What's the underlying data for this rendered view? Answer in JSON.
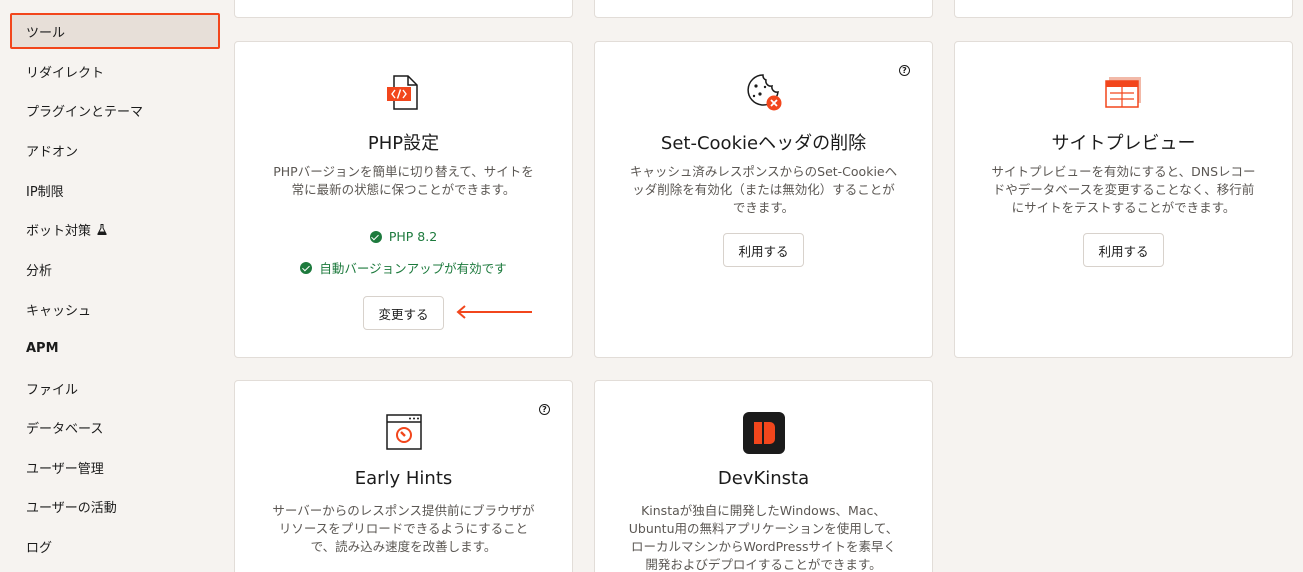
{
  "sidebar": {
    "items": [
      {
        "label": "ツール",
        "active": true
      },
      {
        "label": "リダイレクト"
      },
      {
        "label": "プラグインとテーマ"
      },
      {
        "label": "アドオン"
      },
      {
        "label": "IP制限"
      },
      {
        "label": "ボット対策"
      },
      {
        "label": "分析"
      },
      {
        "label": "キャッシュ"
      },
      {
        "label": "APM"
      },
      {
        "label": "ファイル"
      },
      {
        "label": "データベース"
      },
      {
        "label": "ユーザー管理"
      },
      {
        "label": "ユーザーの活動"
      },
      {
        "label": "ログ"
      }
    ]
  },
  "cards": {
    "php": {
      "title": "PHP設定",
      "desc1": "PHPバージョンを簡単に切り替えて、サイトを",
      "desc2": "常に最新の状態に保つことができます。",
      "status1": "PHP 8.2",
      "status2": "自動バージョンアップが有効です",
      "button": "変更する",
      "icon": "php-code-file-icon"
    },
    "cookie": {
      "title": "Set-Cookieヘッダの削除",
      "desc1": "キャッシュ済みレスポンスからのSet-Cookieヘ",
      "desc2": "ッダ削除を有効化（または無効化）することが",
      "desc3": "できます。",
      "button": "利用する",
      "icon": "cookie-remove-icon"
    },
    "preview": {
      "title": "サイトプレビュー",
      "desc1": "サイトプレビューを有効にすると、DNSレコー",
      "desc2": "ドやデータベースを変更することなく、移行前",
      "desc3": "にサイトをテストすることができます。",
      "button": "利用する",
      "icon": "site-preview-icon"
    },
    "hints": {
      "title": "Early Hints",
      "desc1": "サーバーからのレスポンス提供前にブラウザが",
      "desc2": "リソースをプリロードできるようにすること",
      "desc3": "で、読み込み速度を改善します。",
      "icon": "early-hints-icon"
    },
    "devkinsta": {
      "title": "DevKinsta",
      "desc1": "Kinstaが独自に開発したWindows、Mac、",
      "desc2": "Ubuntu用の無料アプリケーションを使用して、",
      "desc3": "ローカルマシンからWordPressサイトを素早く",
      "desc4": "開発およびデプロイすることができます。",
      "icon": "devkinsta-logo-icon"
    }
  },
  "colors": {
    "accent": "#f2461c",
    "success": "#1d7a3d",
    "background": "#f6f3f0"
  }
}
